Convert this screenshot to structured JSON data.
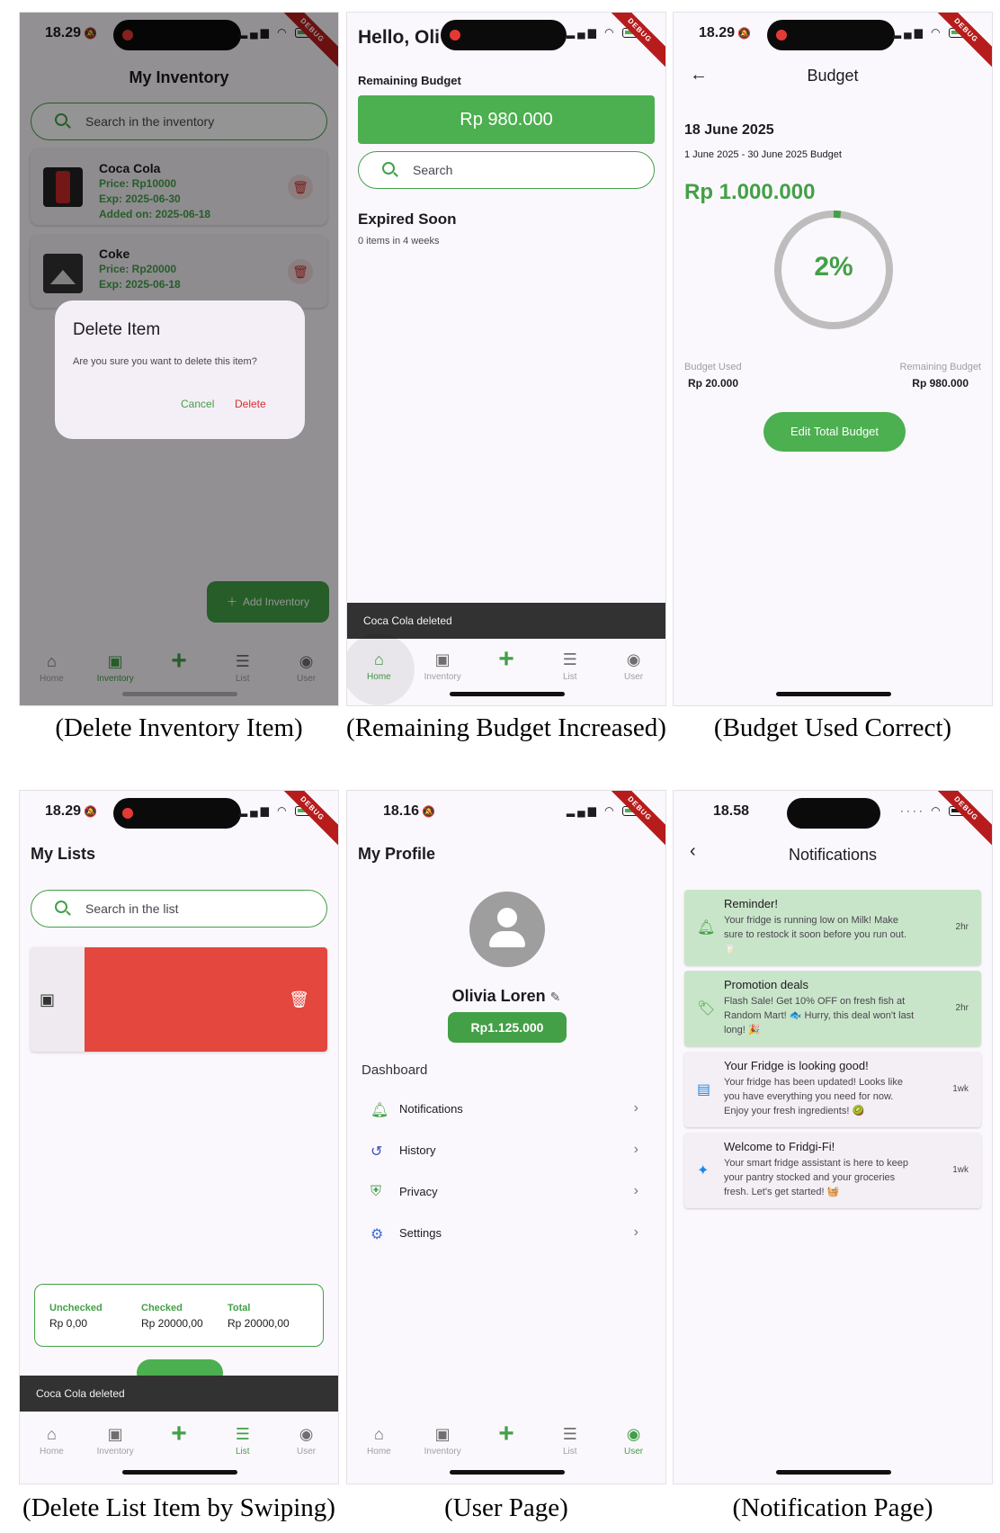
{
  "captions": [
    "(Delete Inventory  Item)",
    "(Remaining Budget Increased)",
    "(Budget Used Correct)",
    "(Delete List Item by Swiping)",
    "(User Page)",
    "(Notification Page)"
  ],
  "status": {
    "time_a": "18.29",
    "time_b": "18.16",
    "time_c": "18.58",
    "debug": "DEBUG"
  },
  "nav": {
    "home": "Home",
    "inventory": "Inventory",
    "list": "List",
    "user": "User"
  },
  "inventory_screen": {
    "title": "My Inventory",
    "search_placeholder": "Search in the inventory",
    "items": [
      {
        "name": "Coca Cola",
        "price": "Price: Rp10000",
        "exp": "Exp: 2025-06-30",
        "added": "Added on: 2025-06-18"
      },
      {
        "name": "Coke",
        "price": "Price: Rp20000",
        "exp": "Exp: 2025-06-18"
      }
    ],
    "dialog": {
      "title": "Delete Item",
      "message": "Are you sure you want to delete this item?",
      "cancel": "Cancel",
      "delete": "Delete"
    },
    "fab_label": "Add Inventory"
  },
  "home_screen": {
    "greeting": "Hello, Oli",
    "remaining_label": "Remaining Budget",
    "remaining_value": "Rp 980.000",
    "search_placeholder": "Search",
    "expired_title": "Expired Soon",
    "expired_sub": "0 items in 4 weeks",
    "snackbar": "Coca Cola deleted"
  },
  "budget_screen": {
    "title": "Budget",
    "date": "18 June 2025",
    "range": "1 June 2025 - 30 June 2025 Budget",
    "total": "Rp 1.000.000",
    "percent_label": "2%",
    "percent_value": 0.02,
    "used_label": "Budget Used",
    "used_value": "Rp 20.000",
    "remaining_label": "Remaining Budget",
    "remaining_value": "Rp 980.000",
    "edit_button": "Edit Total Budget"
  },
  "list_screen": {
    "title": "My Lists",
    "search_placeholder": "Search in the list",
    "summary": {
      "unchecked_label": "Unchecked",
      "unchecked_value": "Rp 0,00",
      "checked_label": "Checked",
      "checked_value": "Rp 20000,00",
      "total_label": "Total",
      "total_value": "Rp 20000,00"
    },
    "snackbar": "Coca Cola deleted"
  },
  "profile_screen": {
    "title": "My Profile",
    "name": "Olivia Loren",
    "balance": "Rp1.125.000",
    "dashboard": "Dashboard",
    "menu": [
      "Notifications",
      "History",
      "Privacy",
      "Settings"
    ]
  },
  "notifications_screen": {
    "title": "Notifications",
    "items": [
      {
        "title": "Reminder!",
        "body": "Your fridge is running low on Milk! Make sure to restock it soon before you run out. 🥛",
        "time": "2hr"
      },
      {
        "title": "Promotion deals",
        "body": "Flash Sale! Get 10% OFF on fresh fish at Random Mart! 🐟 Hurry, this deal won't last long! 🎉",
        "time": "2hr"
      },
      {
        "title": "Your Fridge is looking good!",
        "body": "Your fridge has been updated! Looks like you have everything you need for now. Enjoy your fresh ingredients! 🥝",
        "time": "1wk"
      },
      {
        "title": "Welcome to Fridgi-Fi!",
        "body": "Your smart fridge assistant is here to keep your pantry stocked and your groceries fresh. Let's get started! 🧺",
        "time": "1wk"
      }
    ]
  },
  "colors": {
    "accent": "#43a047",
    "danger": "#e4473e",
    "notif_highlight": "#c9e5c9"
  }
}
